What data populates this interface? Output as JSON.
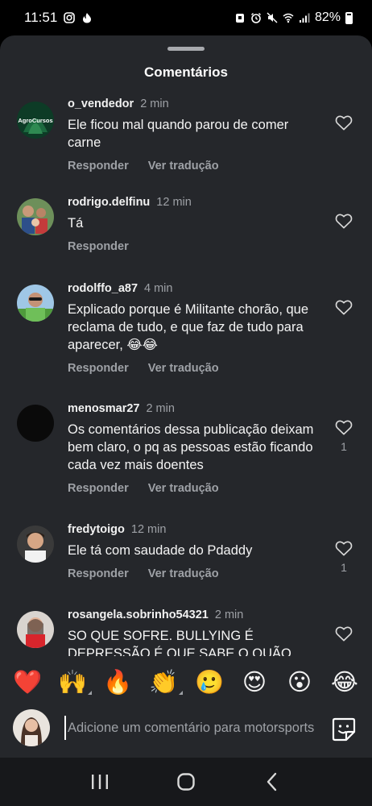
{
  "status_bar": {
    "time": "11:51",
    "battery": "82%"
  },
  "sheet": {
    "title": "Comentários"
  },
  "comments": [
    {
      "username": "o_vendedor",
      "time": "2 min",
      "text": "Ele ficou mal quando parou de comer carne",
      "actions": [
        "Responder",
        "Ver tradução"
      ],
      "likes": "",
      "avatar_label": "AgroCursos"
    },
    {
      "username": "rodrigo.delfinu",
      "time": "12 min",
      "text": "Tá",
      "actions": [
        "Responder"
      ],
      "likes": ""
    },
    {
      "username": "rodolffo_a87",
      "time": "4 min",
      "text": "Explicado porque é Militante chorão, que reclama de tudo, e que faz de tudo para aparecer, 😂😂",
      "actions": [
        "Responder",
        "Ver tradução"
      ],
      "likes": ""
    },
    {
      "username": "menosmar27",
      "time": "2 min",
      "text": "Os comentários dessa publicação deixam bem claro, o pq as pessoas estão ficando cada vez mais doentes",
      "actions": [
        "Responder",
        "Ver tradução"
      ],
      "likes": "1"
    },
    {
      "username": "fredytoigo",
      "time": "12 min",
      "text": "Ele tá com saudade do Pdaddy",
      "actions": [
        "Responder",
        "Ver tradução"
      ],
      "likes": "1"
    },
    {
      "username": "rosangela.sobrinho54321",
      "time": "2 min",
      "text": "SO QUE SOFRE.  BULLYING  É DEPRESSÃO É QUE SABE O QUÃO",
      "actions": [],
      "likes": ""
    }
  ],
  "emoji_bar": [
    "❤️",
    "🙌",
    "🔥",
    "👏",
    "🥲",
    "😍",
    "😮",
    "😂"
  ],
  "input": {
    "placeholder": "Adicione um comentário para motorsports"
  },
  "icons": {
    "like": "heart-outline-icon",
    "sticker": "sticker-icon",
    "nav_recent": "recent-apps-icon",
    "nav_home": "home-icon",
    "nav_back": "back-icon"
  },
  "colors": {
    "sheet_bg": "#25272b",
    "text": "#f2f2f2",
    "muted": "#9ea1a6",
    "nav_bg": "#17181b"
  }
}
